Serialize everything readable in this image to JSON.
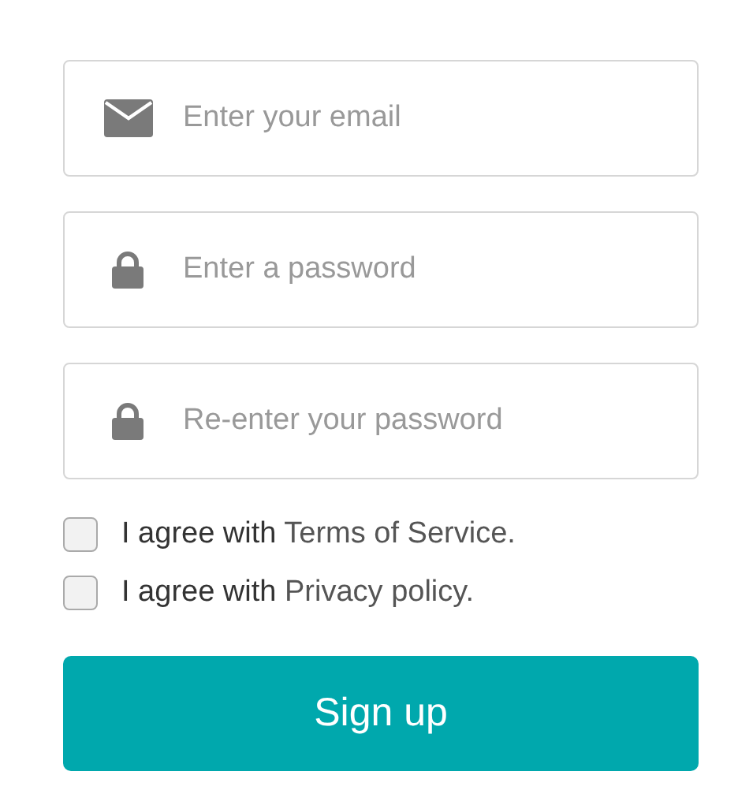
{
  "fields": [
    {
      "kind": "email",
      "placeholder": "Enter your email"
    },
    {
      "kind": "password",
      "placeholder": "Enter a password"
    },
    {
      "kind": "password",
      "placeholder": "Re-enter your password"
    }
  ],
  "agreements": [
    {
      "text": "I agree with",
      "link": "Terms of Service.",
      "checked": false
    },
    {
      "text": "I agree with",
      "link": "Privacy policy.",
      "checked": false
    }
  ],
  "submit": "Sign up"
}
